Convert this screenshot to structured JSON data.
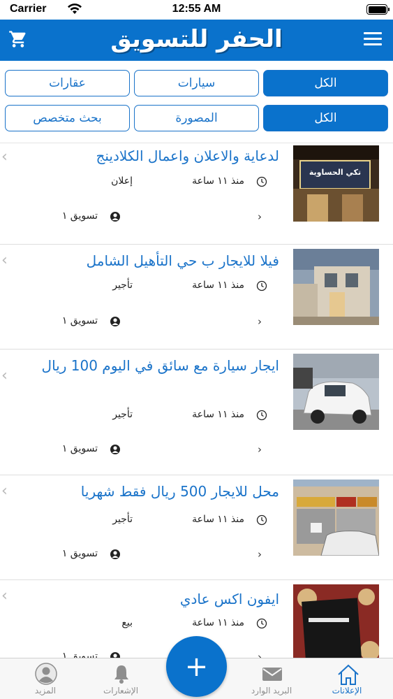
{
  "status_bar": {
    "carrier": "Carrier",
    "time": "12:55 AM"
  },
  "header": {
    "title": "الحفر للتسويق"
  },
  "filters": {
    "row1": [
      "الكل",
      "سيارات",
      "عقارات"
    ],
    "row2": [
      "الكل",
      "المصورة",
      "بحث متخصص"
    ]
  },
  "listings": [
    {
      "title": "لدعاية والاعلان واعمال الكلادينج",
      "time": "منذ ١١ ساعة",
      "category": "إعلان",
      "user": "تسويق ١",
      "thumb_text": "تكي الحساوية"
    },
    {
      "title": "فيلا للايجار ب حي التأهيل الشامل",
      "time": "منذ ١١ ساعة",
      "category": "تأجير",
      "user": "تسويق ١"
    },
    {
      "title": "ايجار سيارة مع سائق في اليوم 100 ريال",
      "time": "منذ ١١ ساعة",
      "category": "تأجير",
      "user": "تسويق ١"
    },
    {
      "title": "محل للايجار 500 ريال فقط شهريا",
      "time": "منذ ١١ ساعة",
      "category": "تأجير",
      "user": "تسويق ١"
    },
    {
      "title": "ايفون اكس عادي",
      "time": "منذ ١١ ساعة",
      "category": "بيع",
      "user": "تسويق ١"
    }
  ],
  "tabs": [
    {
      "label": "المزيد",
      "icon": "profile-icon"
    },
    {
      "label": "الإشعارات",
      "icon": "bell-icon"
    },
    {
      "label": "البريد الوارد",
      "icon": "mail-icon"
    },
    {
      "label": "الإعلانات",
      "icon": "home-icon"
    }
  ],
  "fab": {
    "label": "+"
  },
  "colors": {
    "primary": "#0a72cc",
    "link": "#1a73c9"
  }
}
